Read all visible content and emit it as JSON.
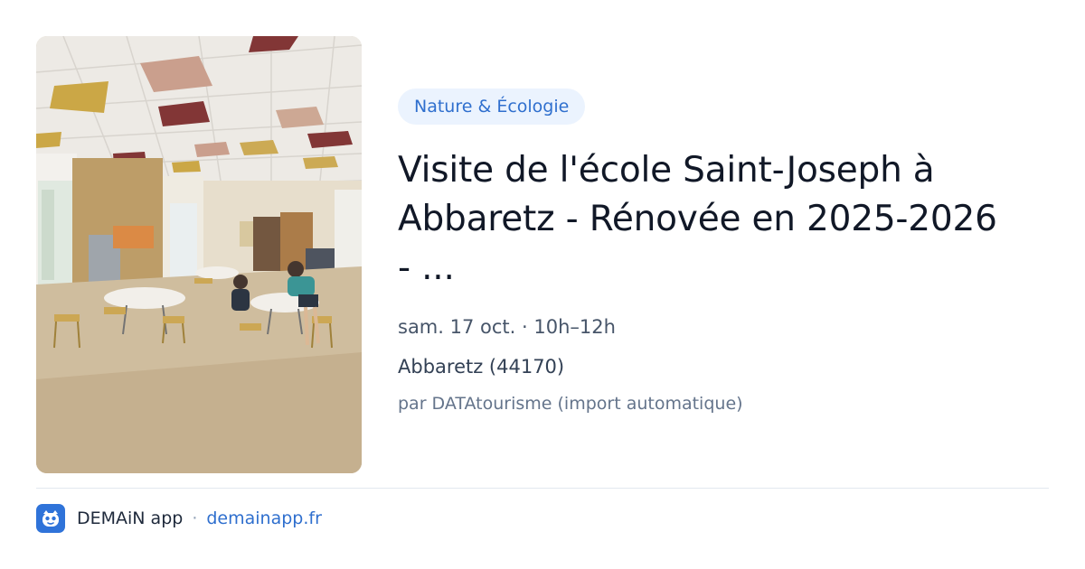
{
  "event": {
    "category": "Nature & Écologie",
    "title_line1": "Visite de l'école Saint-Joseph à",
    "title_line2": "Abbaretz - Rénovée en 2025-2026",
    "title_line3": "- ...",
    "date_time": "sam. 17 oct. · 10h–12h",
    "location": "Abbaretz (44170)",
    "author": "par DATAtourisme (import automatique)"
  },
  "footer": {
    "app_name": "DEMAiN app",
    "separator": "·",
    "domain": "demainapp.fr",
    "app_icon": "demain-logo-icon"
  },
  "colors": {
    "accent": "#2f6fce",
    "tag_background": "#ebf3fe",
    "title": "#111827",
    "muted": "#64748b"
  }
}
